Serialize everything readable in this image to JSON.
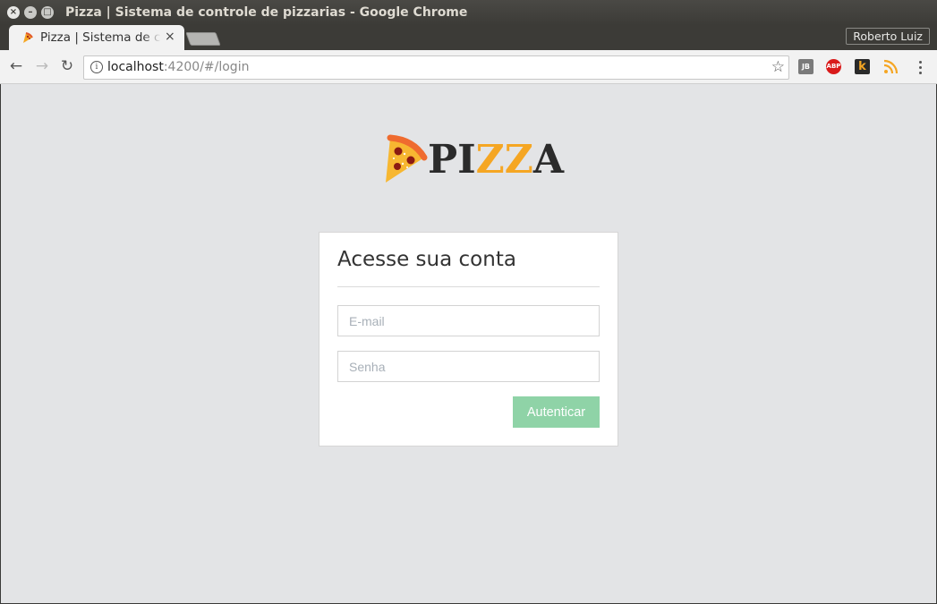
{
  "window": {
    "title": "Pizza | Sistema de controle de pizzarias - Google Chrome",
    "profile": "Roberto Luiz"
  },
  "tab": {
    "title": "Pizza | Sistema de controle de pizzarias",
    "close_glyph": "×"
  },
  "address": {
    "host": "localhost",
    "path": ":4200/#/login"
  },
  "toolbar_icons": {
    "back": "←",
    "forward": "→",
    "reload": "↻",
    "info": "i",
    "star": "☆"
  },
  "extensions": {
    "jb": "JB",
    "abp": "ABP",
    "k": "k"
  },
  "logo": {
    "part1": "PI",
    "part2": "ZZ",
    "part3": "A"
  },
  "login": {
    "title": "Acesse sua conta",
    "email_placeholder": "E-mail",
    "senha_placeholder": "Senha",
    "submit_label": "Autenticar"
  },
  "colors": {
    "accent_orange": "#f5a623",
    "submit_green": "#8fd3a7",
    "page_background": "#e3e4e6"
  }
}
